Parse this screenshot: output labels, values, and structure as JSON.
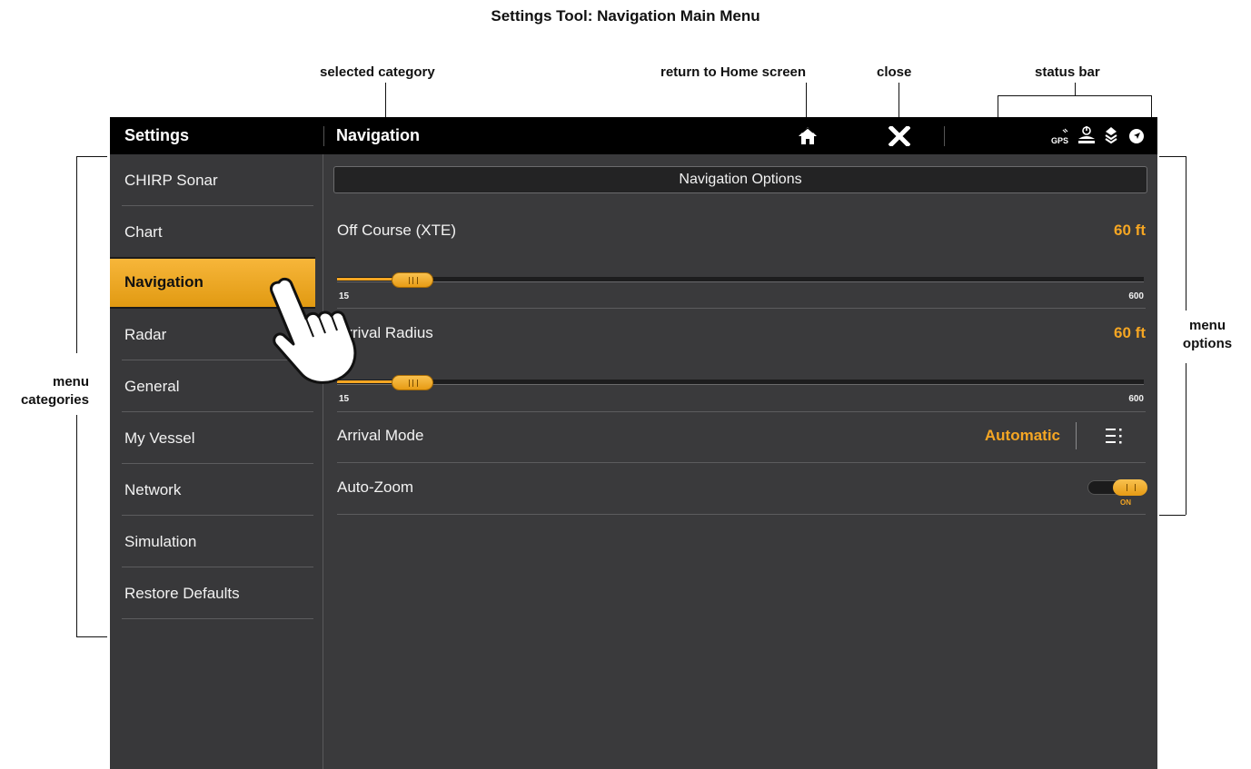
{
  "doc_title": "Settings Tool: Navigation Main Menu",
  "callouts": {
    "selected_category": "selected category",
    "return_home": "return to Home screen",
    "close": "close",
    "status_bar": "status bar",
    "menu_categories_1": "menu",
    "menu_categories_2": "categories",
    "menu_options_1": "menu",
    "menu_options_2": "options"
  },
  "topbar": {
    "settings": "Settings",
    "section": "Navigation",
    "gps_label": "GPS",
    "icons": [
      "home-icon",
      "close-icon",
      "gps-icon",
      "bell-icon",
      "layers-icon",
      "compass-icon"
    ]
  },
  "sidebar": {
    "items": [
      {
        "label": "CHIRP Sonar"
      },
      {
        "label": "Chart"
      },
      {
        "label": "Navigation",
        "selected": true
      },
      {
        "label": "Radar"
      },
      {
        "label": "General"
      },
      {
        "label": "My Vessel"
      },
      {
        "label": "Network"
      },
      {
        "label": "Simulation"
      },
      {
        "label": "Restore Defaults"
      }
    ]
  },
  "main": {
    "header": "Navigation Options",
    "off_course": {
      "label": "Off Course (XTE)",
      "value": "60 ft",
      "min": "15",
      "max": "600"
    },
    "arrival_radius": {
      "label": "Arrival Radius",
      "value": "60 ft",
      "min": "15",
      "max": "600"
    },
    "arrival_mode": {
      "label": "Arrival Mode",
      "value": "Automatic"
    },
    "auto_zoom": {
      "label": "Auto-Zoom",
      "state": "ON"
    }
  },
  "colors": {
    "accent": "#f5a623",
    "screen_bg": "#3a3a3c",
    "topbar_bg": "#000000"
  }
}
